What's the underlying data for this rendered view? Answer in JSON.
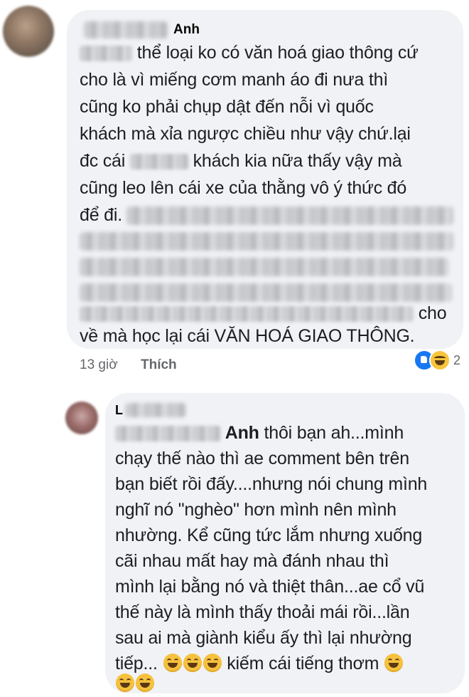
{
  "comment1": {
    "author_name": "Anh",
    "lines": [
      "thể loại ko có văn hoá giao thông cứ",
      "cho là vì miếng cơm manh áo đi nưa thì",
      "cũng ko phải chụp dật đến nỗi vì quốc",
      "khách mà xỉa ngược chiều như vậy chứ.lại",
      "đc cái",
      "khách kia nữa thấy vậy mà",
      "cũng leo lên cái xe của thằng vô ý thức đó",
      "để đi.",
      "cho",
      "về mà học lại cái VĂN HOÁ GIAO THÔNG."
    ],
    "time": "13 giờ",
    "like_label": "Thích",
    "reaction_count": "2",
    "reaction_icons": [
      "like-icon",
      "haha-icon"
    ]
  },
  "comment2": {
    "author_name_partial": "L",
    "mention": "Anh",
    "lines": [
      "thôi bạn ah...mình",
      "chạy thế nào thì ae comment bên trên",
      "bạn biết rồi đấy....nhưng nói chung mình",
      "nghĩ nó \"nghèo\" hơn mình nên mình",
      "nhường. Kể cũng tức lắm nhưng xuống",
      "cãi nhau mất hay mà đánh nhau thì",
      "mình lại bằng nó và thiệt thân...ae cổ vũ",
      "thế này là mình thấy thoải mái rồi...lần",
      "sau ai mà giành kiểu ấy thì lại nhường",
      "tiếp...",
      "kiếm cái tiếng thơm"
    ],
    "emoji_name": "laughing-emoji"
  }
}
